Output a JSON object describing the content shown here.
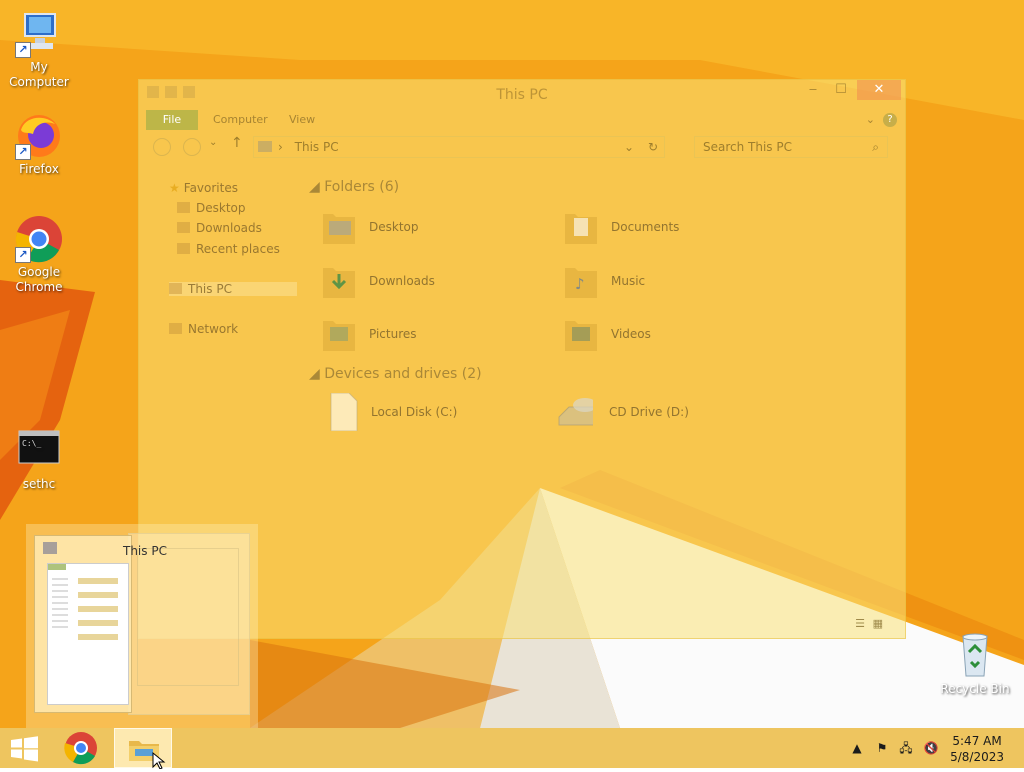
{
  "desktop": {
    "icons": [
      {
        "label": "My Computer",
        "icon": "computer-icon"
      },
      {
        "label": "Firefox",
        "icon": "firefox-icon"
      },
      {
        "label": "Google Chrome",
        "icon": "chrome-icon"
      },
      {
        "label": "sethc",
        "icon": "console-icon"
      },
      {
        "label": "Recycle Bin",
        "icon": "recycle-bin-icon"
      }
    ]
  },
  "explorer": {
    "title": "This PC",
    "ribbon_tabs": [
      "File",
      "Computer",
      "View"
    ],
    "help": "?",
    "address": "This PC",
    "search_placeholder": "Search This PC",
    "nav": {
      "favorites": "Favorites",
      "desktop": "Desktop",
      "downloads": "Downloads",
      "recent": "Recent places",
      "thispc": "This PC",
      "network": "Network"
    },
    "folders_header": "Folders (6)",
    "folders": [
      "Desktop",
      "Documents",
      "Downloads",
      "Music",
      "Pictures",
      "Videos"
    ],
    "devices_header": "Devices and drives (2)",
    "devices": [
      "Local Disk (C:)",
      "CD Drive (D:)"
    ]
  },
  "thumbnail": {
    "title": "This PC"
  },
  "taskbar": {
    "clock_time": "5:47 AM",
    "clock_date": "5/8/2023",
    "tray_icons": [
      "show-hidden-icons-icon",
      "action-center-flag-icon",
      "network-icon",
      "volume-muted-icon"
    ]
  },
  "colors": {
    "desktop_bg": "#f5a41a",
    "taskbar": "#eec45c",
    "file_tab": "#8caa46"
  }
}
